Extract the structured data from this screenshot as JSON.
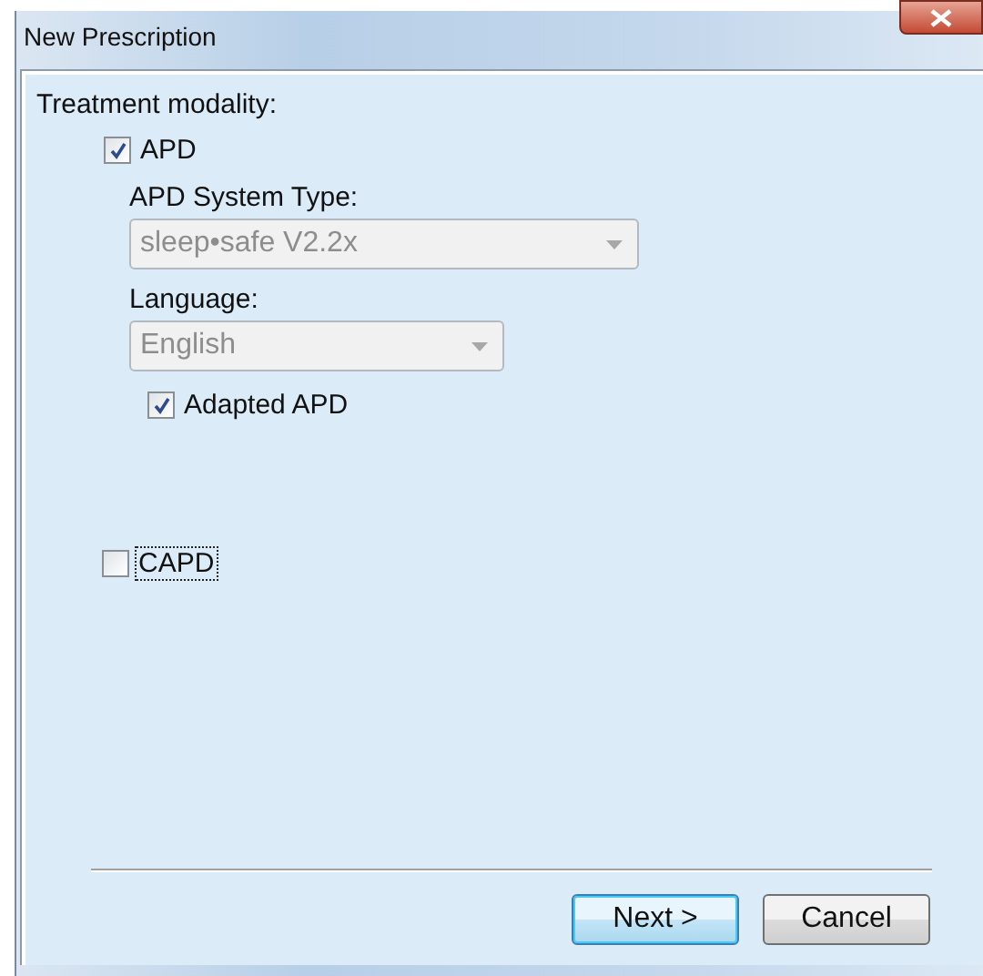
{
  "window": {
    "title": "New Prescription"
  },
  "section_label": "Treatment modality:",
  "apd": {
    "label": "APD",
    "checked": true,
    "system_type": {
      "label": "APD System Type:",
      "value": "sleep•safe V2.2x",
      "disabled": true
    },
    "language": {
      "label": "Language:",
      "value": "English",
      "disabled": true
    },
    "adapted": {
      "label": "Adapted APD",
      "checked": true
    }
  },
  "capd": {
    "label": "CAPD",
    "checked": false,
    "focused": true
  },
  "buttons": [
    {
      "label": "Next >",
      "default": true
    },
    {
      "label": "Cancel",
      "default": false
    }
  ]
}
